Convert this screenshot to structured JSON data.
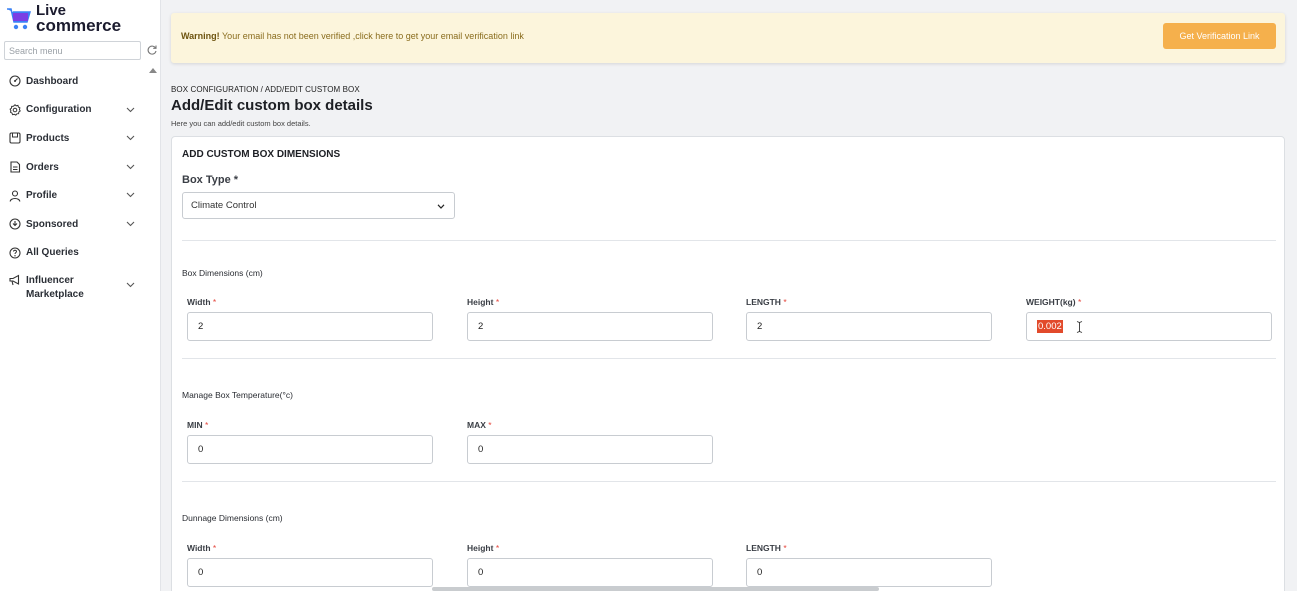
{
  "brand": {
    "line1": "Live",
    "line2": "commerce",
    "accent": "#7b3fe4",
    "cart_color": "#3b82f6"
  },
  "search": {
    "placeholder": "Search menu"
  },
  "sidebar": {
    "items": [
      {
        "label": "Dashboard",
        "icon": "dashboard-icon",
        "has_chevron": false
      },
      {
        "label": "Configuration",
        "icon": "gear-icon",
        "has_chevron": true
      },
      {
        "label": "Products",
        "icon": "product-icon",
        "has_chevron": true
      },
      {
        "label": "Orders",
        "icon": "orders-icon",
        "has_chevron": true
      },
      {
        "label": "Profile",
        "icon": "user-icon",
        "has_chevron": true
      },
      {
        "label": "Sponsored",
        "icon": "sponsored-icon",
        "has_chevron": true
      },
      {
        "label": "All Queries",
        "icon": "question-icon",
        "has_chevron": false
      },
      {
        "label": "Influencer Marketplace",
        "line1": "Influencer",
        "line2": "Marketplace",
        "icon": "megaphone-icon",
        "has_chevron": true
      }
    ]
  },
  "warning": {
    "strong": "Warning!",
    "text": " Your email has not been verified ,click here to get your email verification link",
    "button": "Get Verification Link",
    "bg_color": "#fcf5dc",
    "button_color": "#f5b04c"
  },
  "header": {
    "breadcrumb": "BOX CONFIGURATION / ADD/EDIT CUSTOM BOX",
    "title": "Add/Edit custom box details",
    "subtitle": "Here you can add/edit custom box details."
  },
  "form": {
    "card_title": "ADD CUSTOM BOX DIMENSIONS",
    "box_type_label": "Box Type *",
    "box_type_value": "Climate Control",
    "box_dimensions": {
      "title": "Box Dimensions (cm)",
      "fields": [
        {
          "label": "Width",
          "value": "2"
        },
        {
          "label": "Height",
          "value": "2"
        },
        {
          "label": "LENGTH",
          "value": "2"
        },
        {
          "label": "WEIGHT(kg)",
          "value": "0.002",
          "selected": true
        }
      ]
    },
    "temperature": {
      "title": "Manage Box Temperature(°c)",
      "fields": [
        {
          "label": "MIN",
          "value": "0"
        },
        {
          "label": "MAX",
          "value": "0"
        }
      ]
    },
    "dunnage": {
      "title": "Dunnage Dimensions (cm)",
      "fields": [
        {
          "label": "Width",
          "value": "0"
        },
        {
          "label": "Height",
          "value": "0"
        },
        {
          "label": "LENGTH",
          "value": "0"
        }
      ]
    },
    "required_mark": "*"
  }
}
